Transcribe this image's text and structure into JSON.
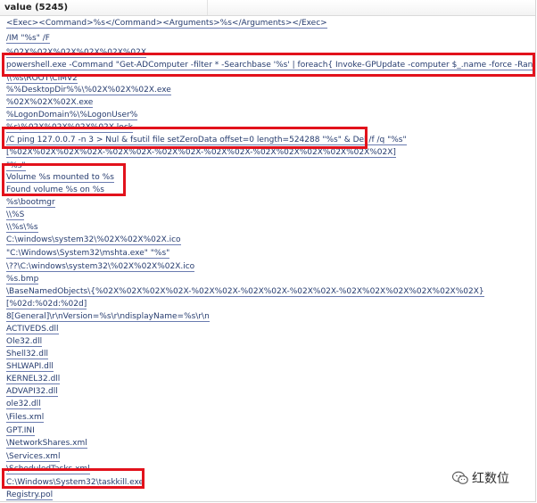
{
  "header": {
    "column_title": "value (5245)"
  },
  "rows": [
    "<Exec><Command>%s</Command><Arguments>%s</Arguments></Exec>",
    "/IM \"%s\" /F",
    "%02X%02X%02X%02X%02X%02X",
    "powershell.exe -Command \"Get-ADComputer -filter * -Searchbase '%s' | foreach{ Invoke-GPUpdate -computer $_.name -force -RandomDelayIn...",
    "\\\\%s\\ROOT\\CIMV2",
    "%%DesktopDir%%\\%02X%02X%02X.exe",
    "%02X%02X%02X.exe",
    "%LogonDomain%\\%LogonUser%",
    "%s\\%02X%02X%02X%02X.lock",
    "/C ping 127.0.0.7 -n 3 > Nul & fsutil file setZeroData offset=0 length=524288 \"%s\" & Del /f /q \"%s\"",
    "[%02X%02X%02X%02X-%02X%02X-%02X%02X-%02X%02X-%02X%02X%02X%02X%02X%02X]",
    "\"%s\"",
    "Volume %s mounted to %s",
    "Found volume %s on %s",
    "%s\\bootmgr",
    "\\\\%S",
    "\\\\%s\\%s",
    "C:\\windows\\system32\\%02X%02X%02X.ico",
    "\"C:\\Windows\\System32\\mshta.exe\" \"%s\"",
    "\\??\\C:\\windows\\system32\\%02X%02X%02X.ico",
    "%s.bmp",
    "\\BaseNamedObjects\\{%02X%02X%02X%02X-%02X%02X-%02X%02X-%02X%02X-%02X%02X%02X%02X%02X%02X}",
    "[%02d:%02d:%02d]",
    "8[General]\\r\\nVersion=%s\\r\\ndisplayName=%s\\r\\n",
    "ACTIVEDS.dll",
    "Ole32.dll",
    "Shell32.dll",
    "SHLWAPI.dll",
    "KERNEL32.dll",
    "ADVAPI32.dll",
    "ole32.dll",
    "\\Files.xml",
    "GPT.INI",
    "\\NetworkShares.xml",
    "\\Services.xml",
    "\\ScheduledTasks.xml",
    "C:\\Windows\\System32\\taskkill.exe",
    "Registry.pol"
  ],
  "watermark": {
    "text": "红数位",
    "icon": "wechat-icon"
  },
  "highlight_color": "#e2121c",
  "link_color": "#253b6e"
}
